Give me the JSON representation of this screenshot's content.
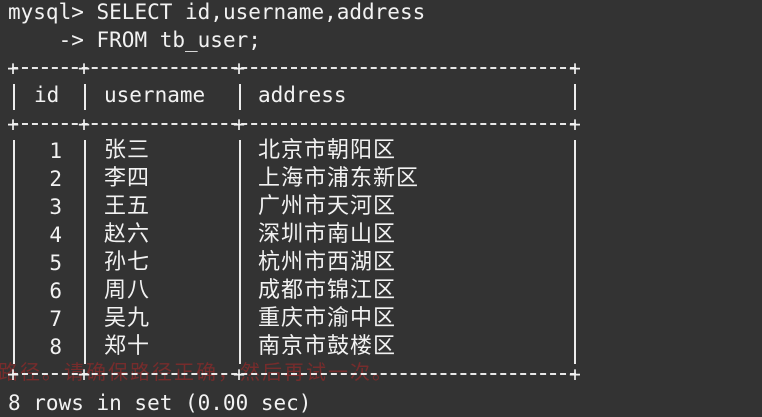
{
  "terminal": {
    "prompt": "mysql> ",
    "query_line_1": "SELECT id,username,address",
    "continuation_prompt": "    -> ",
    "query_line_2": "FROM tb_user;",
    "columns": {
      "id": "id",
      "username": "username",
      "address": "address"
    },
    "rows": [
      {
        "id": "1",
        "username": "张三",
        "address": "北京市朝阳区"
      },
      {
        "id": "2",
        "username": "李四",
        "address": "上海市浦东新区"
      },
      {
        "id": "3",
        "username": "王五",
        "address": "广州市天河区"
      },
      {
        "id": "4",
        "username": "赵六",
        "address": "深圳市南山区"
      },
      {
        "id": "5",
        "username": "孙七",
        "address": "杭州市西湖区"
      },
      {
        "id": "6",
        "username": "周八",
        "address": "成都市锦江区"
      },
      {
        "id": "7",
        "username": "吴九",
        "address": "重庆市渝中区"
      },
      {
        "id": "8",
        "username": "郑十",
        "address": "南京市鼓楼区"
      }
    ],
    "ghost_error_text": "路径。请确保路径正确，然后再试一次。",
    "result_summary": "8 rows in set (0.00 sec)"
  },
  "colors": {
    "background": "#333333",
    "foreground": "#f2f2f2",
    "ghost_text": "#7a2c2c"
  }
}
